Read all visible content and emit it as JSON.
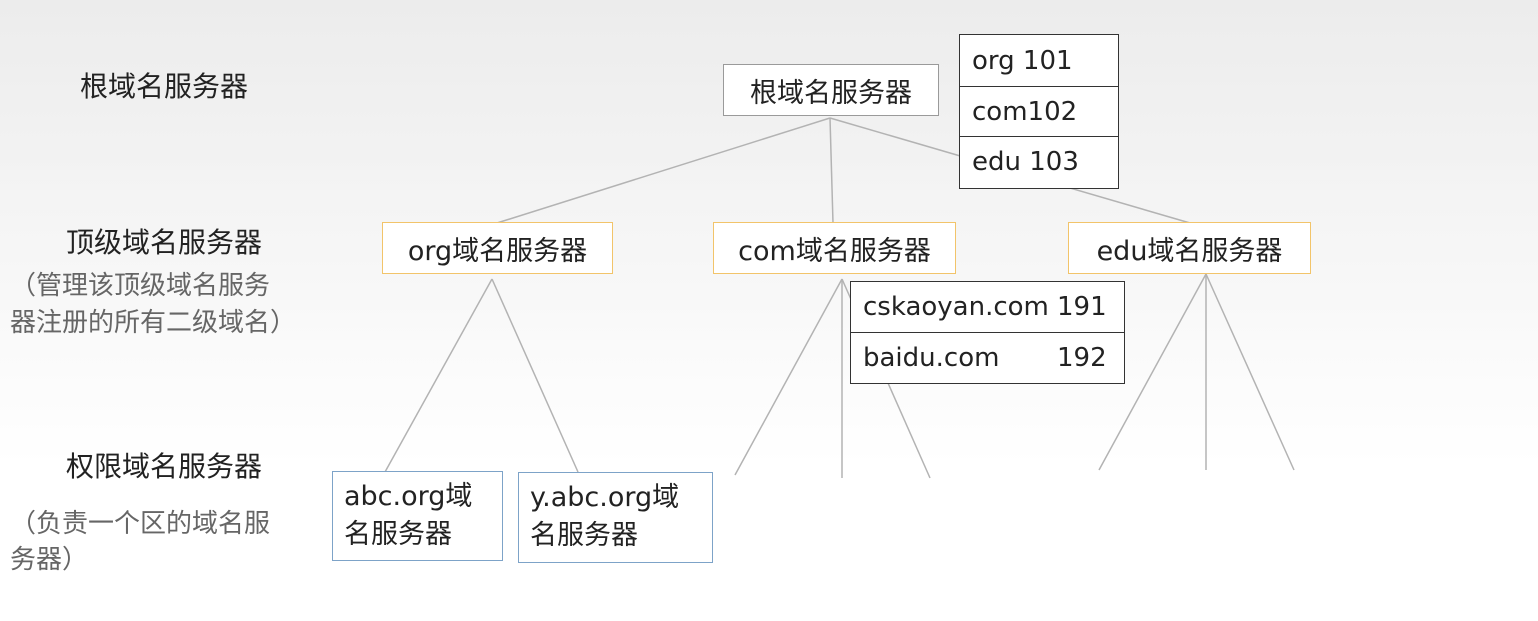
{
  "levels": {
    "root": {
      "title": "根域名服务器"
    },
    "tld": {
      "title": "顶级域名服务器",
      "note_line1": "（管理该顶级域名服务",
      "note_line2": "器注册的所有二级域名）"
    },
    "authoritative": {
      "title": "权限域名服务器",
      "note_line1": "（负责一个区的域名服",
      "note_line2": "务器）"
    }
  },
  "nodes": {
    "root": "根域名服务器",
    "org": "org域名服务器",
    "com": "com域名服务器",
    "edu": "edu域名服务器",
    "abc_org_line1": "abc.org域",
    "abc_org_line2": "名服务器",
    "y_abc_org_line1": "y.abc.org域",
    "y_abc_org_line2": "名服务器"
  },
  "root_table": [
    {
      "name": "org 101"
    },
    {
      "name": "com102"
    },
    {
      "name": "edu 103"
    }
  ],
  "com_table": [
    {
      "name": "cskaoyan.com",
      "ip": "191"
    },
    {
      "name": "baidu.com",
      "ip": "192"
    }
  ]
}
